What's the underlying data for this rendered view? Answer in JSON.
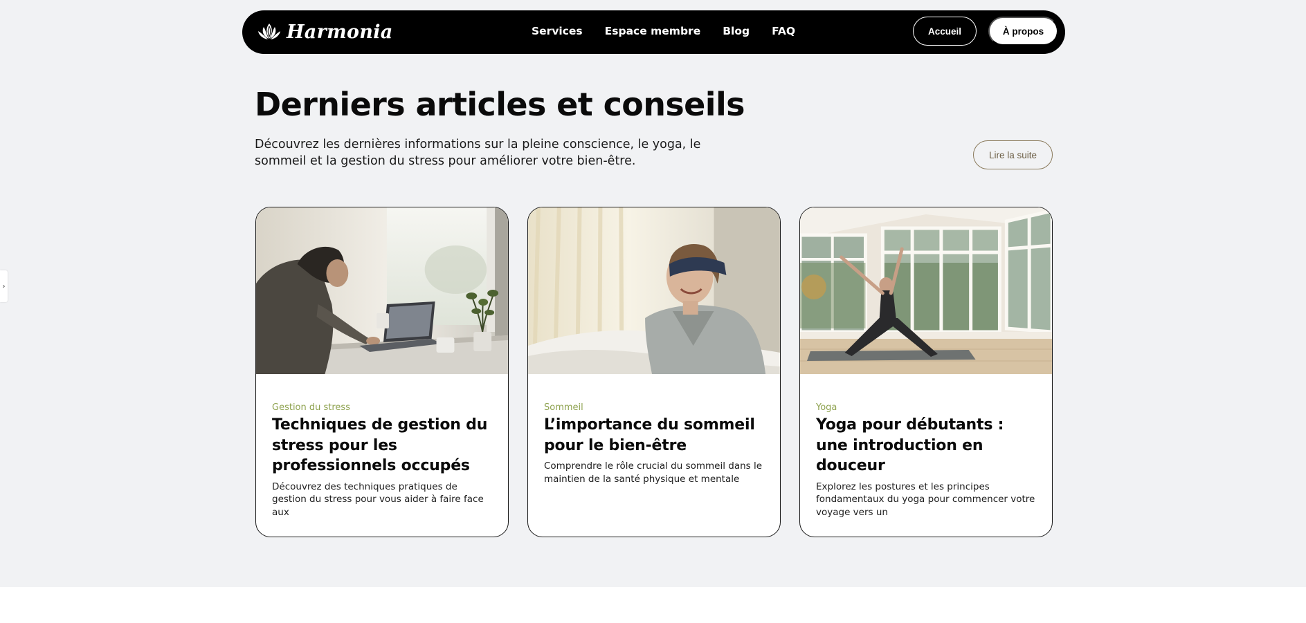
{
  "brand": {
    "name": "Harmonia",
    "icon": "lotus-icon"
  },
  "nav": {
    "links": [
      "Services",
      "Espace membre",
      "Blog",
      "FAQ"
    ],
    "accueil_label": "Accueil",
    "apropos_label": "À propos"
  },
  "side_tab": {
    "icon": "chevron-right-icon",
    "glyph": "›"
  },
  "section": {
    "title": "Derniers articles et conseils",
    "intro": "Découvrez les dernières informations sur la pleine conscience, le yoga, le sommeil et la gestion du stress pour améliorer votre bien-être.",
    "read_more_label": "Lire la suite"
  },
  "articles": [
    {
      "category": "Gestion du stress",
      "title": "Techniques de gestion du stress pour les professionnels occupés",
      "excerpt": "Découvrez des techniques pratiques de gestion du stress pour vous aider à faire face aux"
    },
    {
      "category": "Sommeil",
      "title": "L’importance du sommeil pour le bien-être",
      "excerpt": "Comprendre le rôle crucial du sommeil dans le maintien de la santé physique et mentale"
    },
    {
      "category": "Yoga",
      "title": "Yoga pour débutants : une introduction en douceur",
      "excerpt": "Explorez les postures et les principes fondamentaux du yoga pour commencer votre voyage vers un"
    }
  ],
  "colors": {
    "background": "#f1f2f4",
    "nav": "#000000",
    "category_accent": "#8ea24f",
    "read_more_border": "#8a7a5b"
  }
}
